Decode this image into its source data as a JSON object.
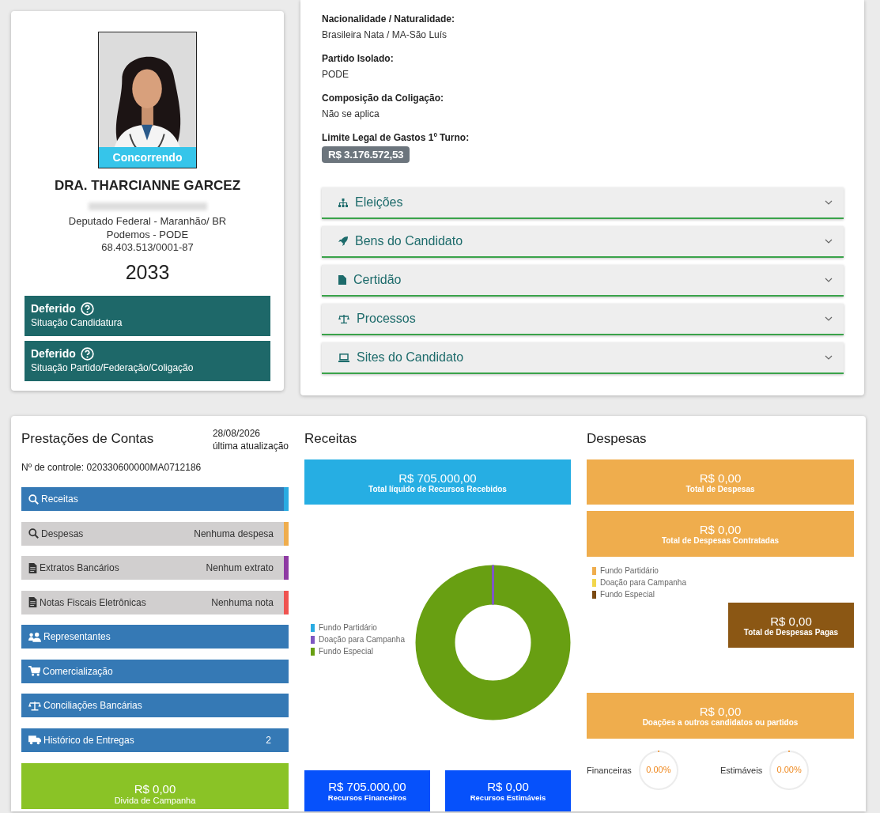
{
  "candidate": {
    "status_badge": "Concorrendo",
    "name": "DRA. THARCIANNE GARCEZ",
    "office": "Deputado Federal - Maranhão/ BR",
    "party": "Podemos - PODE",
    "cnpj": "68.403.513/0001-87",
    "number": "2033",
    "situations": [
      {
        "status": "Deferido",
        "label": "Situação Candidatura"
      },
      {
        "status": "Deferido",
        "label": "Situação Partido/Federação/Coligação"
      }
    ]
  },
  "details": {
    "fields": [
      {
        "label": "Nacionalidade / Naturalidade:",
        "value": "Brasileira Nata / MA-São Luís"
      },
      {
        "label": "Partido Isolado:",
        "value": "PODE"
      },
      {
        "label": "Composição da Coligação:",
        "value": "Não se aplica"
      }
    ],
    "spending_limit": {
      "label": "Limite Legal de Gastos 1º Turno:",
      "value": "R$ 3.176.572,53"
    },
    "sections": [
      {
        "label": "Eleições",
        "expanded": false
      },
      {
        "label": "Bens do Candidato",
        "expanded": false
      },
      {
        "label": "Certidão",
        "expanded": false
      },
      {
        "label": "Processos",
        "expanded": false
      },
      {
        "label": "Sites do Candidato",
        "expanded": false
      }
    ]
  },
  "accounts": {
    "title": "Prestações de Contas",
    "date": "28/08/2026",
    "date_caption": "última atualização",
    "control_number": "Nº de controle: 020330600000MA0712186",
    "items": [
      {
        "label": "Receitas",
        "kind": "link",
        "color": "#29abe2"
      },
      {
        "label": "Despesas",
        "kind": "empty",
        "note": "Nenhuma despesa",
        "color": "#efad4d"
      },
      {
        "label": "Extratos Bancários",
        "kind": "empty",
        "note": "Nenhum extrato",
        "color": "#8e3aa3"
      },
      {
        "label": "Notas Fiscais Eletrônicas",
        "kind": "empty",
        "note": "Nenhuma nota",
        "color": "#ef5350"
      },
      {
        "label": "Representantes",
        "kind": "link"
      },
      {
        "label": "Comercialização",
        "kind": "link"
      },
      {
        "label": "Conciliações Bancárias",
        "kind": "link"
      },
      {
        "label": "Histórico de Entregas",
        "kind": "link",
        "count": "2"
      }
    ],
    "debt": {
      "value": "R$ 0,00",
      "label": "Divida de Campanha"
    }
  },
  "receipts": {
    "title": "Receitas",
    "total": {
      "value": "R$ 705.000,00",
      "label": "Total líquido de Recursos Recebidos"
    },
    "legend": [
      {
        "label": "Fundo Partidário",
        "color": "#29abe2"
      },
      {
        "label": "Doação para Campanha",
        "color": "#7e57c2"
      },
      {
        "label": "Fundo Especial",
        "color": "#689f12"
      }
    ],
    "breakdown": [
      {
        "value": "R$ 705.000,00",
        "label": "Recursos Financeiros"
      },
      {
        "value": "R$ 0,00",
        "label": "Recursos Estimáveis"
      }
    ]
  },
  "expenses": {
    "title": "Despesas",
    "boxes": [
      {
        "value": "R$ 0,00",
        "label": "Total de Despesas"
      },
      {
        "value": "R$ 0,00",
        "label": "Total de Despesas Contratadas"
      }
    ],
    "legend": [
      {
        "label": "Fundo Partidário",
        "color": "#efad4d"
      },
      {
        "label": "Doação para Campanha",
        "color": "#f2d64b"
      },
      {
        "label": "Fundo Especial",
        "color": "#7b4a12"
      }
    ],
    "paid": {
      "value": "R$ 0,00",
      "label": "Total de Despesas Pagas"
    },
    "donations": {
      "value": "R$ 0,00",
      "label": "Doações a outros candidatos ou partidos"
    },
    "gauges": [
      {
        "label": "Financeiras",
        "reading": "0.00%",
        "level": 0
      },
      {
        "label": "Estimáveis",
        "reading": "0.00%",
        "level": 0
      }
    ]
  }
}
